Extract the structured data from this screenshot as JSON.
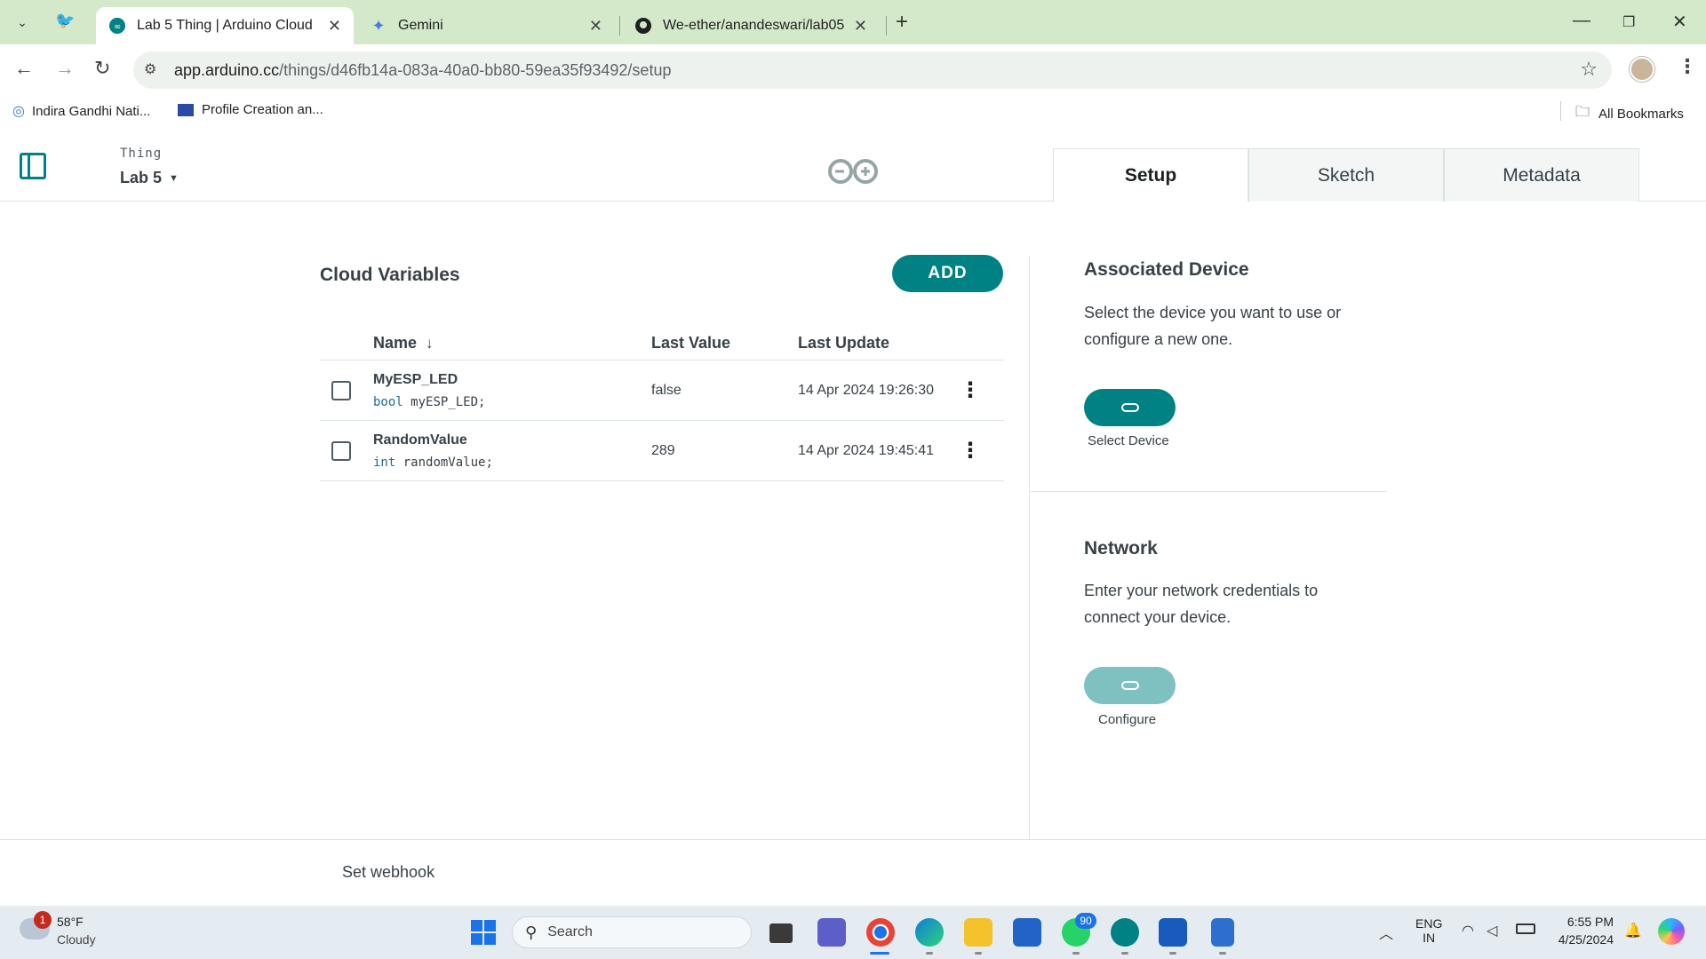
{
  "browser": {
    "tabs": [
      {
        "title": "Lab 5 Thing | Arduino Cloud",
        "active": true
      },
      {
        "title": "Gemini",
        "active": false
      },
      {
        "title": "We-ether/anandeswari/lab05",
        "active": false
      }
    ],
    "url": {
      "host": "app.arduino.cc",
      "path": "/things/d46fb14a-083a-40a0-bb80-59ea35f93492/setup"
    },
    "bookmarks": [
      "Indira Gandhi Nati...",
      "Profile Creation an..."
    ],
    "all_bookmarks_label": "All Bookmarks"
  },
  "app": {
    "thing_label": "Thing",
    "thing_name": "Lab 5",
    "tabs": [
      "Setup",
      "Sketch",
      "Metadata"
    ],
    "active_tab": "Setup"
  },
  "variables": {
    "title": "Cloud Variables",
    "add_label": "ADD",
    "columns": {
      "name": "Name",
      "last_value": "Last Value",
      "last_update": "Last Update"
    },
    "rows": [
      {
        "name": "MyESP_LED",
        "type": "bool",
        "decl": "myESP_LED;",
        "value": "false",
        "updated": "14 Apr 2024 19:26:30"
      },
      {
        "name": "RandomValue",
        "type": "int",
        "decl": "randomValue;",
        "value": "289",
        "updated": "14 Apr 2024 19:45:41"
      }
    ]
  },
  "device": {
    "title": "Associated Device",
    "desc_line1": "Select the device you want to use or",
    "desc_line2": "configure a new one.",
    "button_label": "Select Device"
  },
  "network": {
    "title": "Network",
    "desc_line1": "Enter your network credentials to",
    "desc_line2": "connect your device.",
    "button_label": "Configure"
  },
  "footer": {
    "webhook_label": "Set webhook"
  },
  "taskbar": {
    "weather_temp": "58°F",
    "weather_desc": "Cloudy",
    "weather_badge": "1",
    "search_placeholder": "Search",
    "whatsapp_badge": "90",
    "lang_line1": "ENG",
    "lang_line2": "IN",
    "time": "6:55 PM",
    "date": "4/25/2024"
  },
  "colors": {
    "teal": "#008184",
    "teal_light": "#7fc0c1",
    "tabstrip": "#d3e9c9"
  }
}
